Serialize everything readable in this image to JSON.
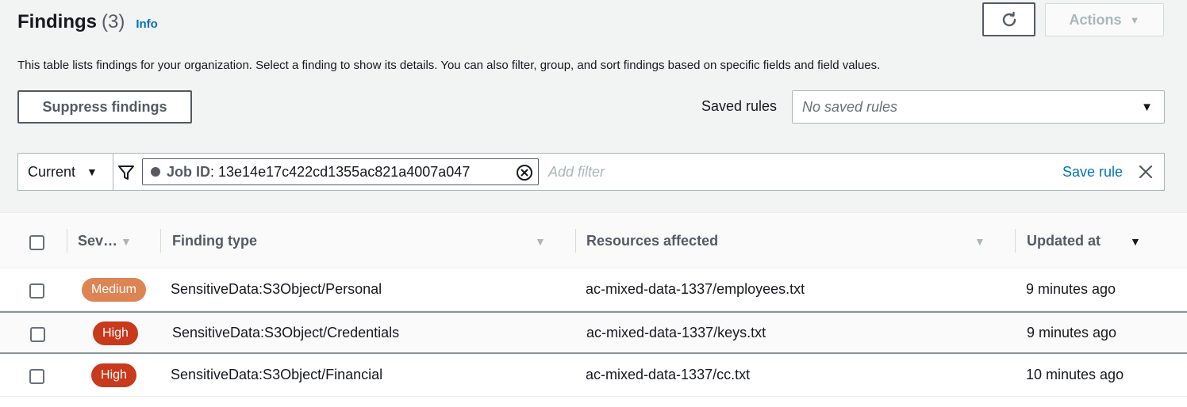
{
  "header": {
    "title": "Findings",
    "count": "(3)",
    "info": "Info",
    "actions_label": "Actions",
    "description": "This table lists findings for your organization. Select a finding to show its details. You can also filter, group, and sort findings based on specific fields and field values."
  },
  "toolbar": {
    "suppress_label": "Suppress findings",
    "saved_rules_label": "Saved rules",
    "saved_rules_value": "No saved rules"
  },
  "filter": {
    "scope": "Current",
    "token_key": "Job ID",
    "token_value": ": 13e14e17c422cd1355ac821a4007a047",
    "add_placeholder": "Add filter",
    "save_rule": "Save rule"
  },
  "table": {
    "columns": [
      "Sev…",
      "Finding type",
      "Resources affected",
      "Updated at"
    ],
    "rows": [
      {
        "severity": "Medium",
        "severity_color": "#dd8452",
        "type": "SensitiveData:S3Object/Personal",
        "resource": "ac-mixed-data-1337/employees.txt",
        "updated": "9 minutes ago"
      },
      {
        "severity": "High",
        "severity_color": "#c9391c",
        "type": "SensitiveData:S3Object/Credentials",
        "resource": "ac-mixed-data-1337/keys.txt",
        "updated": "9 minutes ago"
      },
      {
        "severity": "High",
        "severity_color": "#c9391c",
        "type": "SensitiveData:S3Object/Financial",
        "resource": "ac-mixed-data-1337/cc.txt",
        "updated": "10 minutes ago"
      }
    ]
  },
  "icons": {
    "refresh": "refresh-icon",
    "actions_caret": "caret-down-icon",
    "filter": "filter-icon",
    "token_remove": "remove-token-icon",
    "clear": "close-icon"
  }
}
